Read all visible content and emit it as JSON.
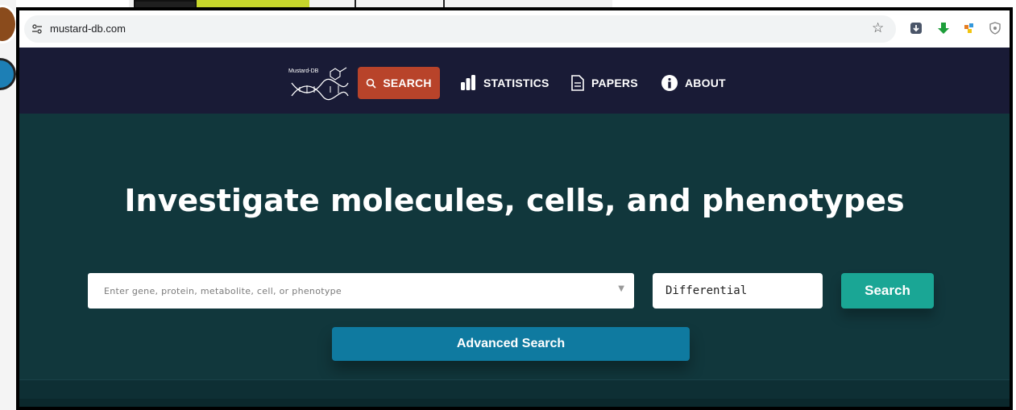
{
  "browser": {
    "url": "mustard-db.com",
    "site_icon": "tune-icon",
    "star_icon": "star-icon",
    "extensions": [
      "download-icon",
      "green-arrow-icon",
      "puzzle-icon",
      "shield-icon"
    ]
  },
  "nav": {
    "logo_text": "Mustard-DB",
    "items": [
      {
        "label": "SEARCH",
        "icon": "search-icon",
        "active": true
      },
      {
        "label": "STATISTICS",
        "icon": "bar-chart-icon"
      },
      {
        "label": "PAPERS",
        "icon": "document-icon"
      },
      {
        "label": "ABOUT",
        "icon": "info-icon"
      }
    ]
  },
  "hero": {
    "title": "Investigate molecules, cells, and phenotypes"
  },
  "search": {
    "placeholder": "Enter gene, protein, metabolite, cell, or phenotype",
    "mode": "Differential",
    "button_label": "Search",
    "advanced_label": "Advanced Search"
  },
  "colors": {
    "navbar_bg": "#191b36",
    "page_bg": "#11373c",
    "search_nav_active": "#b8432a",
    "search_button": "#1aa695",
    "advanced_button": "#0f7aa0"
  }
}
